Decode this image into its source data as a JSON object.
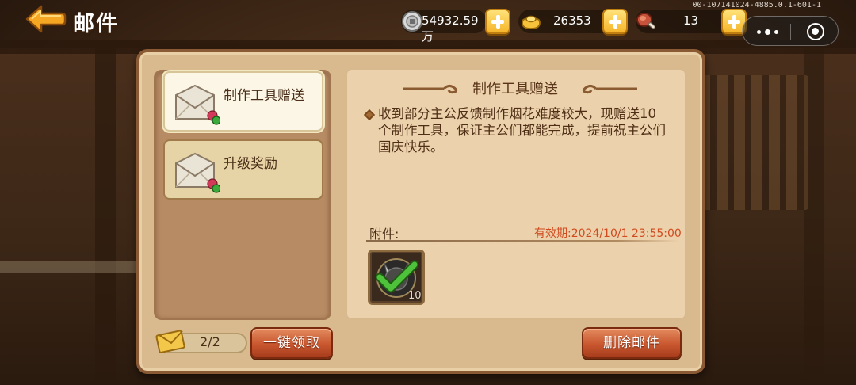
{
  "header": {
    "title": "邮件",
    "build_id": "00-107141024-4885.0.1-601-1"
  },
  "resources": {
    "silver": {
      "value": "54932.59万",
      "icon": "silver-coin-icon"
    },
    "gold": {
      "value": "26353",
      "icon": "gold-ingot-icon"
    },
    "meat": {
      "value": "13",
      "icon": "meat-icon"
    }
  },
  "mail_list": {
    "items": [
      {
        "label": "制作工具赠送",
        "selected": true
      },
      {
        "label": "升级奖励",
        "selected": false
      }
    ],
    "count": "2/2",
    "claim_all_label": "一键领取"
  },
  "mail_detail": {
    "title": "制作工具赠送",
    "body": "收到部分主公反馈制作烟花难度较大，现赠送10个制作工具，保证主公们都能完成，提前祝主公们国庆快乐。",
    "attachment_label": "附件:",
    "expiry": "有效期:2024/10/1 23:55:00",
    "attachment": {
      "icon": "crafting-tool-icon",
      "count": "10"
    },
    "delete_label": "删除邮件"
  },
  "colors": {
    "panel": "#d9b98e",
    "accent_red": "#c9572f",
    "expiry_red": "#d14b20"
  }
}
